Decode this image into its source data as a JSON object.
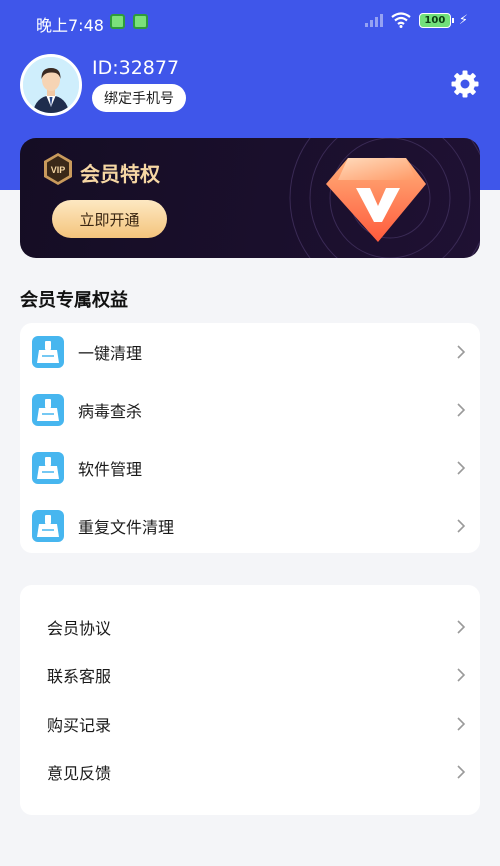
{
  "status_bar": {
    "time": "晚上7:48",
    "battery": "100"
  },
  "profile": {
    "user_id": "ID:32877",
    "bind_phone_label": "绑定手机号"
  },
  "vip_card": {
    "badge_text": "VIP",
    "title": "会员特权",
    "button_label": "立即开通",
    "colors": {
      "title": "#f6d7a4",
      "button": "#f4c47c"
    }
  },
  "benefits": {
    "title": "会员专属权益",
    "items": [
      {
        "label": "一键清理",
        "icon": "broom-icon"
      },
      {
        "label": "病毒查杀",
        "icon": "broom-icon"
      },
      {
        "label": "软件管理",
        "icon": "broom-icon"
      },
      {
        "label": "重复文件清理",
        "icon": "broom-icon"
      }
    ]
  },
  "settings": {
    "items": [
      {
        "label": "会员协议"
      },
      {
        "label": "联系客服"
      },
      {
        "label": "购买记录"
      },
      {
        "label": "意见反馈"
      }
    ]
  },
  "theme": {
    "primary": "#3f56ea",
    "background": "#f4f5f8",
    "feature_icon": "#47b6ef"
  }
}
